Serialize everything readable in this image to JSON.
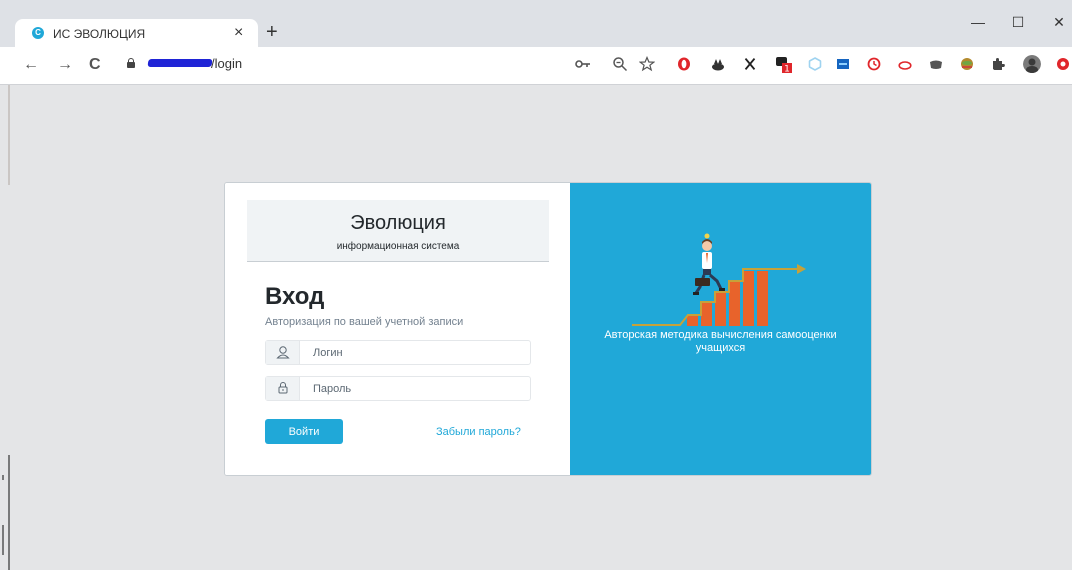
{
  "browser": {
    "tab_title": "ИС ЭВОЛЮЦИЯ",
    "tab_favicon": "C",
    "tab_close": "×",
    "new_tab": "+",
    "url_path": "/login",
    "window_controls": {
      "minimize": "—",
      "maximize": "☐",
      "close": "✕"
    },
    "nav": {
      "back": "←",
      "forward": "→",
      "reload": "C"
    },
    "toolbar_icons": [
      "key-icon",
      "zoom-icon",
      "star-icon"
    ],
    "extensions": [
      {
        "name": "opera-extension-icon",
        "color": "#e0262b"
      },
      {
        "name": "cat-extension-icon",
        "color": "#333333"
      },
      {
        "name": "x-extension-icon",
        "color": "#222222"
      },
      {
        "name": "chat-extension-icon",
        "color": "#222222",
        "badge": "1"
      },
      {
        "name": "hexagon-extension-icon",
        "color": "#9fd3f0"
      },
      {
        "name": "box-extension-icon",
        "color": "#1565c0"
      },
      {
        "name": "timer-extension-icon",
        "color": "#e0262b"
      },
      {
        "name": "cloud-extension-icon",
        "color": "#e0262b"
      },
      {
        "name": "card-extension-icon",
        "color": "#555555"
      },
      {
        "name": "globe-extension-icon",
        "color": "#8a6d1e"
      },
      {
        "name": "puzzle-extension-icon",
        "color": "#444444"
      },
      {
        "name": "profile-avatar-icon",
        "color": "#6b6b6b"
      },
      {
        "name": "menu-extension-icon",
        "color": "#e0262b"
      }
    ]
  },
  "brand": {
    "title": "Эволюция",
    "subtitle": "информационная система"
  },
  "login": {
    "heading": "Вход",
    "subtitle": "Авторизация по вашей учетной записи",
    "username_placeholder": "Логин",
    "password_placeholder": "Пароль",
    "submit_label": "Войти",
    "forgot_label": "Забыли пароль?"
  },
  "promo": {
    "text_line1": "Авторская методика вычисления самооценки",
    "text_line2": "учащихся"
  },
  "colors": {
    "accent": "#20a8d8",
    "bars": "#e8632b",
    "page_bg": "#e4e5e7"
  }
}
